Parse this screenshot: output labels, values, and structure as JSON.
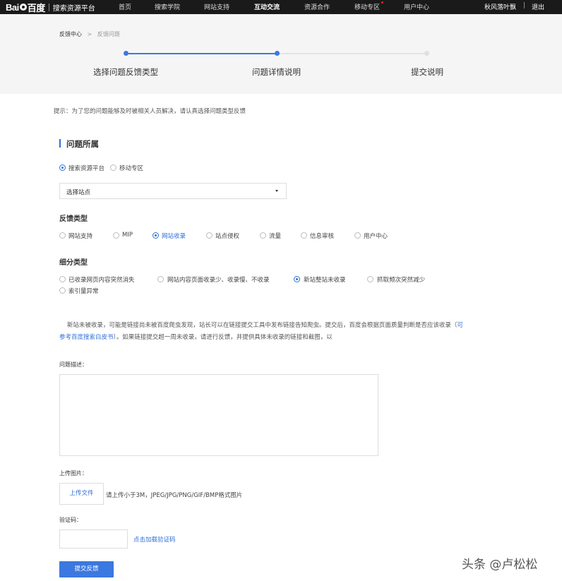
{
  "nav": {
    "logo_mark": "Bai",
    "logo_mark_2": "百度",
    "logo_text": "搜索资源平台",
    "items": [
      "首页",
      "搜索学院",
      "网站支持",
      "互动交流",
      "资源合作",
      "移动专区",
      "用户中心"
    ],
    "user_name": "秋风落叶飘",
    "separator": "|",
    "logout": "退出"
  },
  "breadcrumb": {
    "home": "反馈中心",
    "separator": ">",
    "current": "反馈问题"
  },
  "steps": [
    "选择问题反馈类型",
    "问题详情说明",
    "提交说明"
  ],
  "tip": "提示：为了您的问题能够及时被相关人员解决，请认真选择问题类型反馈",
  "section": {
    "title": "问题所属",
    "platforms": [
      "搜索资源平台",
      "移动专区"
    ],
    "select_site": "选择站点"
  },
  "feedback_type": {
    "title": "反馈类型",
    "options": [
      "网站支持",
      "MIP",
      "网站收录",
      "站点侵权",
      "流量",
      "信息审核",
      "用户中心"
    ]
  },
  "sub_type": {
    "title": "细分类型",
    "options": [
      "已收录网页内容突然消失",
      "网站内容页面收录少、收录慢、不收录",
      "新站整站未收录",
      "抓取频次突然减少",
      "索引量异常"
    ]
  },
  "description": {
    "text_1": "新站未被收录，可能是链接尚未被百度爬虫发现，站长可以在链接提交工具中发布链接告知爬虫。提交后，百度会根据页面质量判断是否应该收录（",
    "link_1": "可",
    "link_2": "参考百度搜索白皮书",
    "text_2": "）。如果链接提交超一周未收录，请进行反馈，并提供具体未收录的链接和截图，以"
  },
  "form": {
    "problem_label": "问题描述：",
    "upload_label": "上传图片：",
    "upload_button": "上传文件",
    "upload_hint": "请上传小于3M，JPEG/JPG/PNG/GIF/BMP格式图片",
    "captcha_label": "验证码：",
    "captcha_link": "点击加载验证码",
    "submit": "提交反馈"
  },
  "watermark": "头条 @卢松松",
  "colors": {
    "accent": "#2f6fd8",
    "nav_bg": "#1a1a1a",
    "steps_bg": "#f5f5f5",
    "submit_bg": "#3b78e0"
  }
}
